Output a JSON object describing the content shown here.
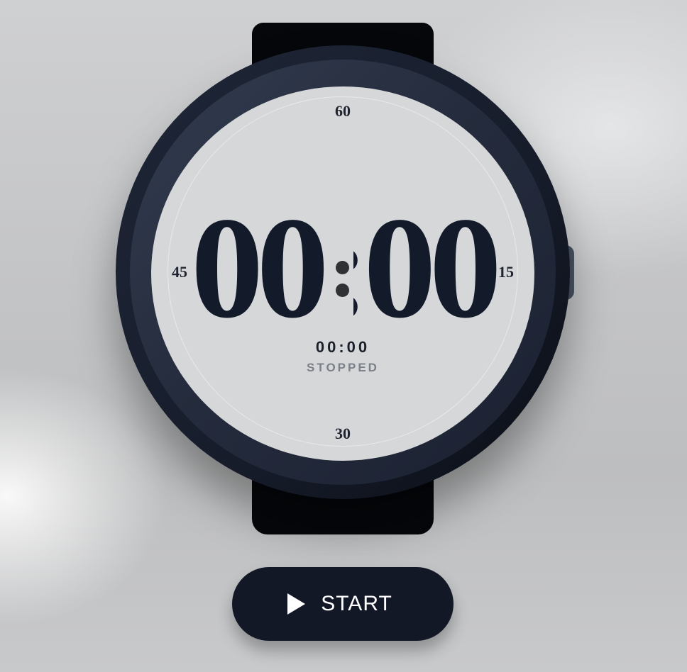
{
  "watch": {
    "main_time": "00:00",
    "sub_time": "00:00",
    "status": "STOPPED",
    "markers": {
      "top": "60",
      "right": "15",
      "bottom": "30",
      "left": "45"
    }
  },
  "controls": {
    "start_label": "START",
    "start_icon": "play-icon"
  },
  "colors": {
    "case": "#161c2a",
    "dial": "#d6d7d9",
    "digits": "#131a2a",
    "button": "#131827",
    "status_text": "#7b7f88"
  }
}
